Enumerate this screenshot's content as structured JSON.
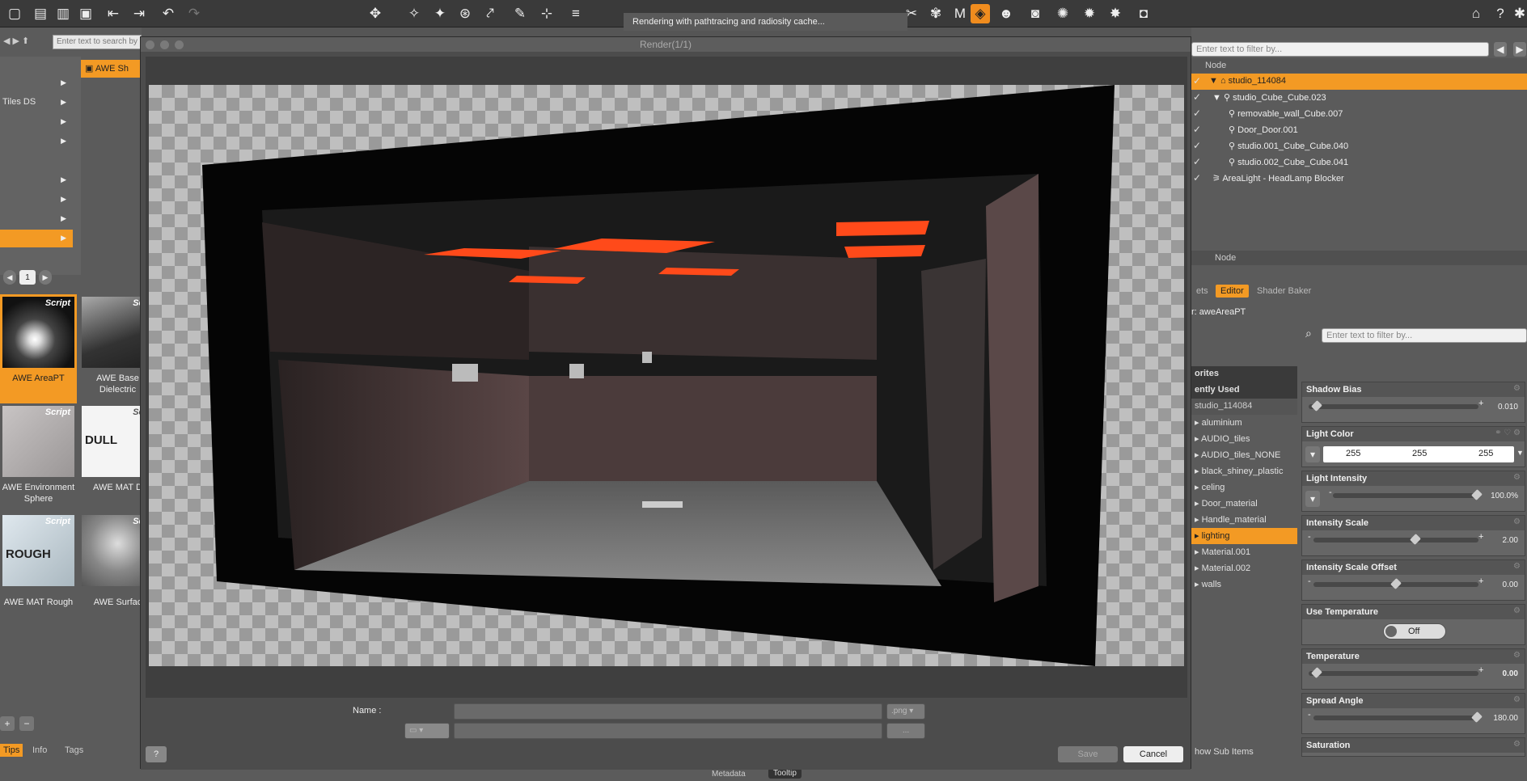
{
  "notice": {
    "text": "Rendering with pathtracing and radiosity cache..."
  },
  "left": {
    "search_placeholder": "Enter text to search by",
    "category_label": "Tiles DS",
    "category_tab": "AWE Sh",
    "page": "1",
    "tiles": [
      {
        "badge": "Script",
        "label": "AWE AreaPT",
        "thumbtxt": ""
      },
      {
        "badge": "Scri",
        "label": "AWE Base Dielectric",
        "thumbtxt": ""
      },
      {
        "badge": "Script",
        "label": "AWE Environment Sphere",
        "thumbtxt": ""
      },
      {
        "badge": "Scri",
        "label": "AWE MAT D",
        "thumbtxt": "DULL"
      },
      {
        "badge": "Script",
        "label": "AWE MAT Rough",
        "thumbtxt": "ROUGH"
      },
      {
        "badge": "Scri",
        "label": "AWE Surfac",
        "thumbtxt": ""
      }
    ],
    "tabs": [
      "Tips",
      "Info",
      "Tags"
    ]
  },
  "dialog": {
    "title": "Render(1/1)",
    "name_label": "Name :",
    "format": ".png",
    "browse": "...",
    "save": "Save",
    "cancel": "Cancel",
    "help": "?"
  },
  "right": {
    "filter_placeholder": "Enter text to filter by...",
    "scene_header": "Node",
    "scene_items": [
      "studio_114084",
      "studio_Cube_Cube.023",
      "removable_wall_Cube.007",
      "Door_Door.001",
      "studio.001_Cube_Cube.040",
      "studio.002_Cube_Cube.041",
      "AreaLight - HeadLamp Blocker"
    ],
    "node_header": "Node",
    "tabs": [
      "ets",
      "Editor",
      "Shader Baker"
    ],
    "shader_name": "r: aweAreaPT",
    "prop_filter_placeholder": "Enter text to filter by...",
    "materials": [
      "orites",
      "ently Used",
      "studio_114084",
      "aluminium",
      "AUDIO_tiles",
      "AUDIO_tiles_NONE",
      "black_shiney_plastic",
      "celing",
      "Door_material",
      "Handle_material",
      "lighting",
      "Material.001",
      "Material.002",
      "walls"
    ],
    "show_sub_items": "how Sub Items",
    "props": {
      "shadow_bias": {
        "title": "Shadow Bias",
        "value": "0.010"
      },
      "light_color": {
        "title": "Light Color",
        "r": "255",
        "g": "255",
        "b": "255"
      },
      "light_intensity": {
        "title": "Light Intensity",
        "value": "100.0%"
      },
      "intensity_scale": {
        "title": "Intensity Scale",
        "value": "2.00"
      },
      "intensity_scale_offset": {
        "title": "Intensity Scale Offset",
        "value": "0.00"
      },
      "use_temperature": {
        "title": "Use Temperature",
        "value": "Off"
      },
      "temperature": {
        "title": "Temperature",
        "value": "0.00"
      },
      "spread_angle": {
        "title": "Spread Angle",
        "value": "180.00"
      },
      "saturation": {
        "title": "Saturation"
      }
    }
  },
  "bottom_strip": [
    "Metadata",
    "Tooltip"
  ],
  "colors": {
    "accent": "#f39a24",
    "panel": "#5b5b5b",
    "dark": "#3a3a3a"
  }
}
